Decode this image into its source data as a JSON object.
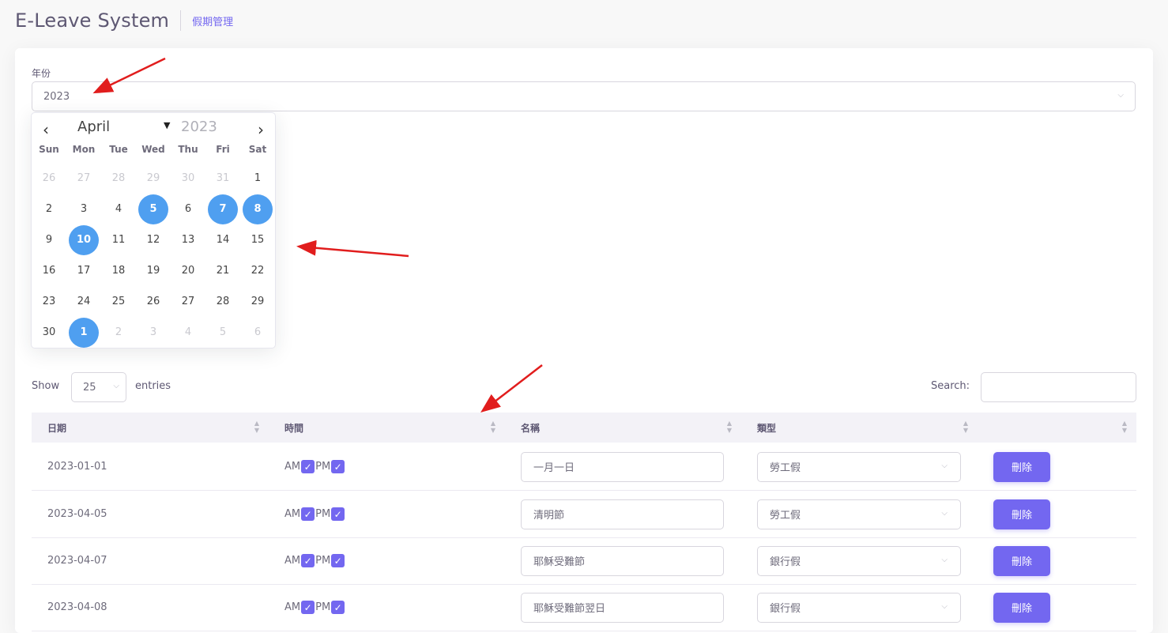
{
  "header": {
    "title": "E-Leave System",
    "breadcrumb": "假期管理"
  },
  "year_filter": {
    "label": "年份",
    "value": "2023",
    "chevron_icon": "chevron-down-icon"
  },
  "calendar": {
    "month": "April",
    "year": "2023",
    "weekdays": [
      "Sun",
      "Mon",
      "Tue",
      "Wed",
      "Thu",
      "Fri",
      "Sat"
    ],
    "weeks": [
      [
        {
          "d": "26",
          "muted": true
        },
        {
          "d": "27",
          "muted": true
        },
        {
          "d": "28",
          "muted": true
        },
        {
          "d": "29",
          "muted": true
        },
        {
          "d": "30",
          "muted": true
        },
        {
          "d": "31",
          "muted": true
        },
        {
          "d": "1"
        }
      ],
      [
        {
          "d": "2"
        },
        {
          "d": "3"
        },
        {
          "d": "4"
        },
        {
          "d": "5",
          "selected": true
        },
        {
          "d": "6"
        },
        {
          "d": "7",
          "selected": true
        },
        {
          "d": "8",
          "selected": true
        }
      ],
      [
        {
          "d": "9"
        },
        {
          "d": "10",
          "selected": true
        },
        {
          "d": "11"
        },
        {
          "d": "12"
        },
        {
          "d": "13"
        },
        {
          "d": "14"
        },
        {
          "d": "15"
        }
      ],
      [
        {
          "d": "16"
        },
        {
          "d": "17"
        },
        {
          "d": "18"
        },
        {
          "d": "19"
        },
        {
          "d": "20"
        },
        {
          "d": "21"
        },
        {
          "d": "22"
        }
      ],
      [
        {
          "d": "23"
        },
        {
          "d": "24"
        },
        {
          "d": "25"
        },
        {
          "d": "26"
        },
        {
          "d": "27"
        },
        {
          "d": "28"
        },
        {
          "d": "29"
        }
      ],
      [
        {
          "d": "30"
        },
        {
          "d": "1",
          "muted": true,
          "selected": true
        },
        {
          "d": "2",
          "muted": true
        },
        {
          "d": "3",
          "muted": true
        },
        {
          "d": "4",
          "muted": true
        },
        {
          "d": "5",
          "muted": true
        },
        {
          "d": "6",
          "muted": true
        }
      ]
    ],
    "selected_color": "#4f9ff0"
  },
  "table_controls": {
    "show_label": "Show",
    "page_length": "25",
    "entries_label": "entries",
    "search_label": "Search:",
    "search_value": ""
  },
  "table": {
    "columns": [
      "日期",
      "時間",
      "名稱",
      "類型",
      ""
    ],
    "rows": [
      {
        "date": "2023-01-01",
        "am": "AM",
        "pm": "PM",
        "name": "一月一日",
        "type": "勞工假",
        "action": "刪除"
      },
      {
        "date": "2023-04-05",
        "am": "AM",
        "pm": "PM",
        "name": "清明節",
        "type": "勞工假",
        "action": "刪除"
      },
      {
        "date": "2023-04-07",
        "am": "AM",
        "pm": "PM",
        "name": "耶穌受難節",
        "type": "銀行假",
        "action": "刪除"
      },
      {
        "date": "2023-04-08",
        "am": "AM",
        "pm": "PM",
        "name": "耶穌受難節翌日",
        "type": "銀行假",
        "action": "刪除"
      }
    ]
  },
  "colors": {
    "accent": "#7367f0",
    "annotation_arrow": "#e11d1d"
  }
}
